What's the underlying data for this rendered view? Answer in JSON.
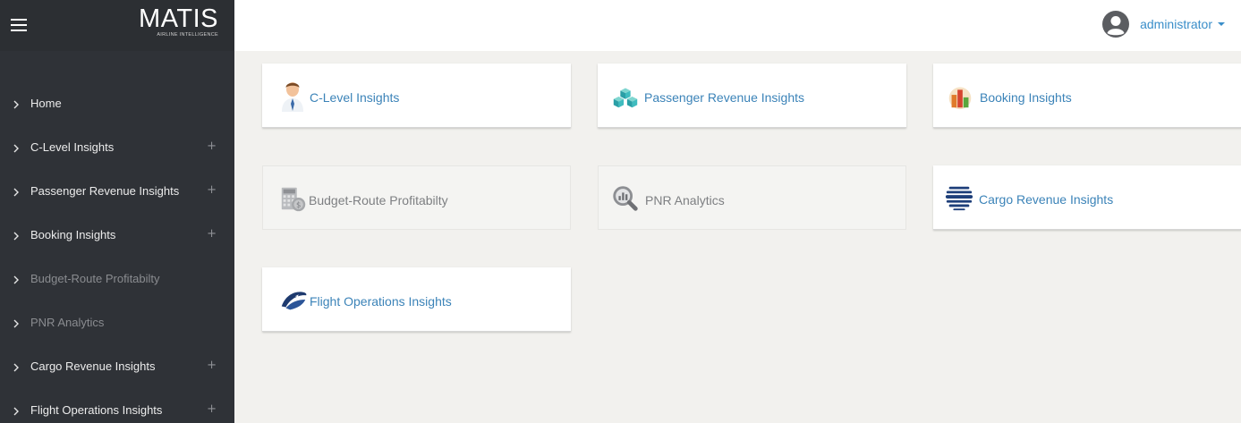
{
  "brand": {
    "name": "MATIS",
    "tagline": "AIRLINE INTELLIGENCE"
  },
  "topbar": {
    "username": "administrator"
  },
  "sidebar": {
    "items": [
      {
        "label": "Home",
        "expandable": false,
        "disabled": false
      },
      {
        "label": "C-Level Insights",
        "expandable": true,
        "disabled": false
      },
      {
        "label": "Passenger Revenue Insights",
        "expandable": true,
        "disabled": false
      },
      {
        "label": "Booking Insights",
        "expandable": true,
        "disabled": false
      },
      {
        "label": "Budget-Route Profitabilty",
        "expandable": false,
        "disabled": true
      },
      {
        "label": "PNR Analytics",
        "expandable": false,
        "disabled": true
      },
      {
        "label": "Cargo Revenue Insights",
        "expandable": true,
        "disabled": false
      },
      {
        "label": "Flight Operations Insights",
        "expandable": true,
        "disabled": false
      }
    ],
    "plus_symbol": "+"
  },
  "tiles": [
    {
      "label": "C-Level Insights",
      "icon": "executive-icon",
      "disabled": false
    },
    {
      "label": "Passenger Revenue Insights",
      "icon": "cubes-icon",
      "disabled": false
    },
    {
      "label": "Booking Insights",
      "icon": "bar-chart-icon",
      "disabled": false
    },
    {
      "label": "Budget-Route Profitabilty",
      "icon": "calculator-coin-icon",
      "disabled": true
    },
    {
      "label": "PNR Analytics",
      "icon": "magnifier-icon",
      "disabled": true
    },
    {
      "label": "Cargo Revenue Insights",
      "icon": "globe-icon",
      "disabled": false
    },
    {
      "label": "Flight Operations Insights",
      "icon": "airline-logo-icon",
      "disabled": false
    }
  ],
  "colors": {
    "sidebar_bg": "#2f3237",
    "content_bg": "#f2f1ee",
    "link_blue": "#3b83b8",
    "disabled_text": "#7d7f82"
  }
}
